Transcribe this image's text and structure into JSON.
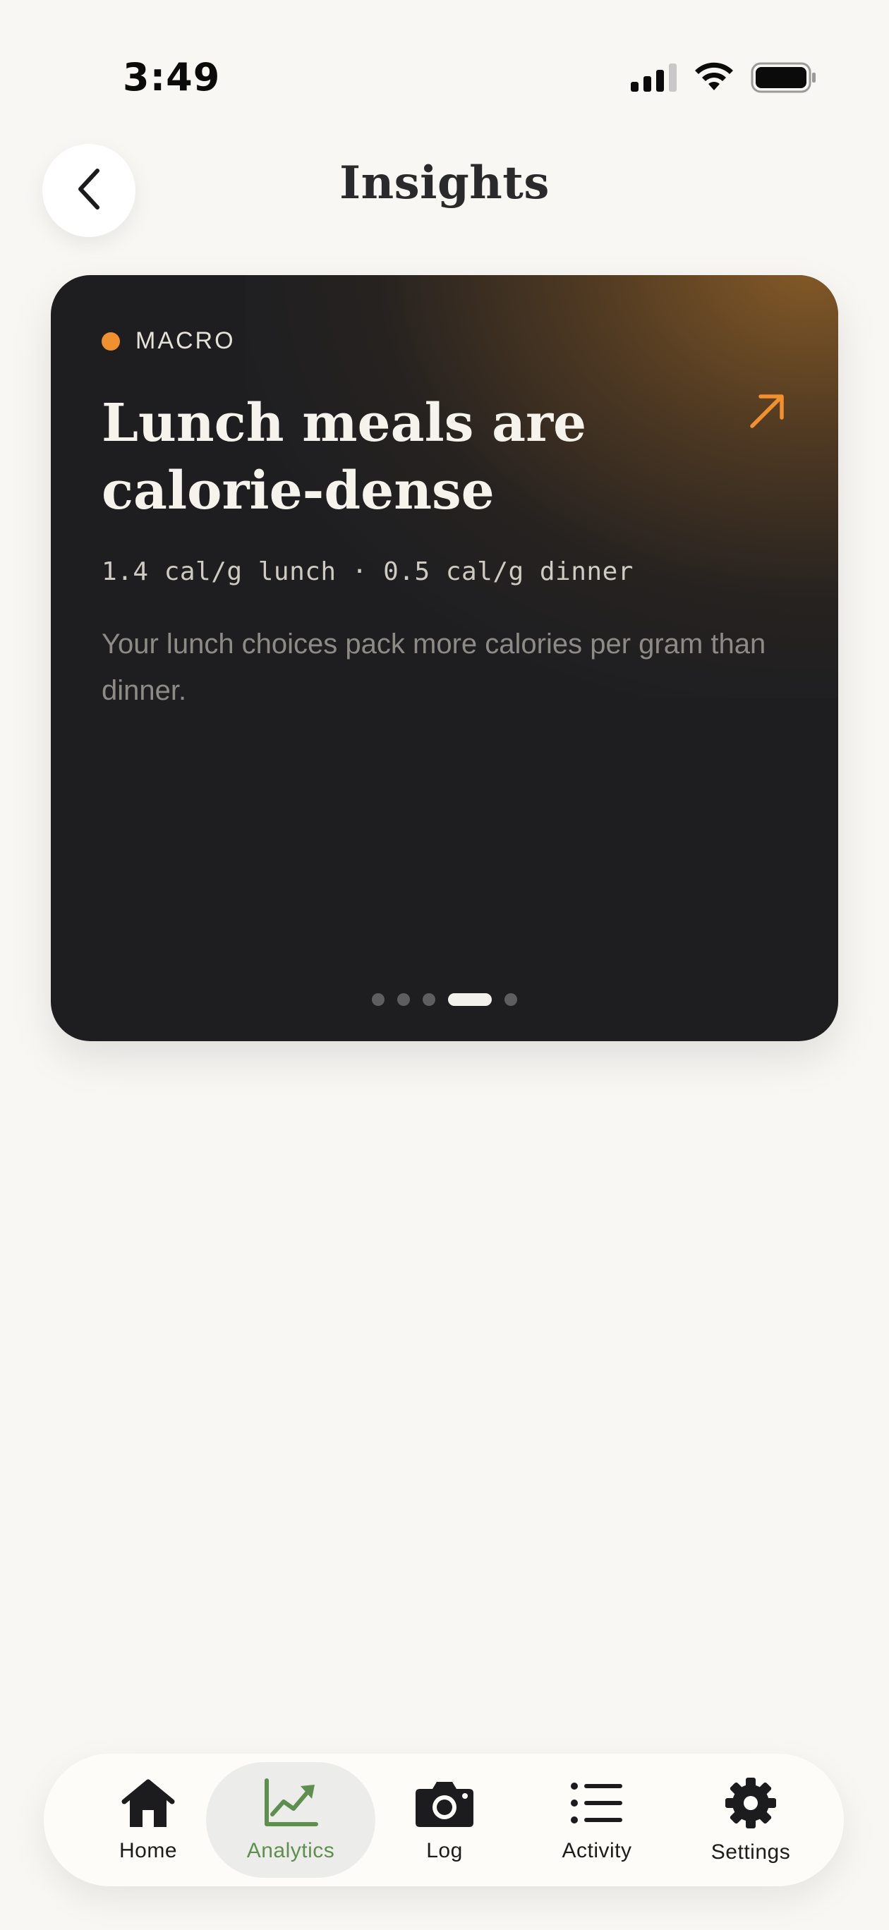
{
  "status_bar": {
    "time": "3:49",
    "icons": [
      "cellular-signal-icon",
      "wifi-icon",
      "battery-icon"
    ]
  },
  "header": {
    "title": "Insights",
    "back_icon": "chevron-left-icon"
  },
  "insight_card": {
    "category": "MACRO",
    "category_color": "#f0902e",
    "title": "Lunch meals are calorie-dense",
    "metric": "1.4 cal/g lunch · 0.5 cal/g dinner",
    "description": "Your lunch choices pack more calories per gram than dinner.",
    "trend_icon": "arrow-up-right-icon",
    "pager": {
      "total": 5,
      "current": 4
    }
  },
  "tab_bar": {
    "items": [
      {
        "label": "Home",
        "icon": "home-icon",
        "active": false
      },
      {
        "label": "Analytics",
        "icon": "chart-trend-icon",
        "active": true
      },
      {
        "label": "Log",
        "icon": "camera-icon",
        "active": false
      },
      {
        "label": "Activity",
        "icon": "list-icon",
        "active": false
      },
      {
        "label": "Settings",
        "icon": "gear-icon",
        "active": false
      }
    ],
    "active_color": "#5f8f4f"
  }
}
